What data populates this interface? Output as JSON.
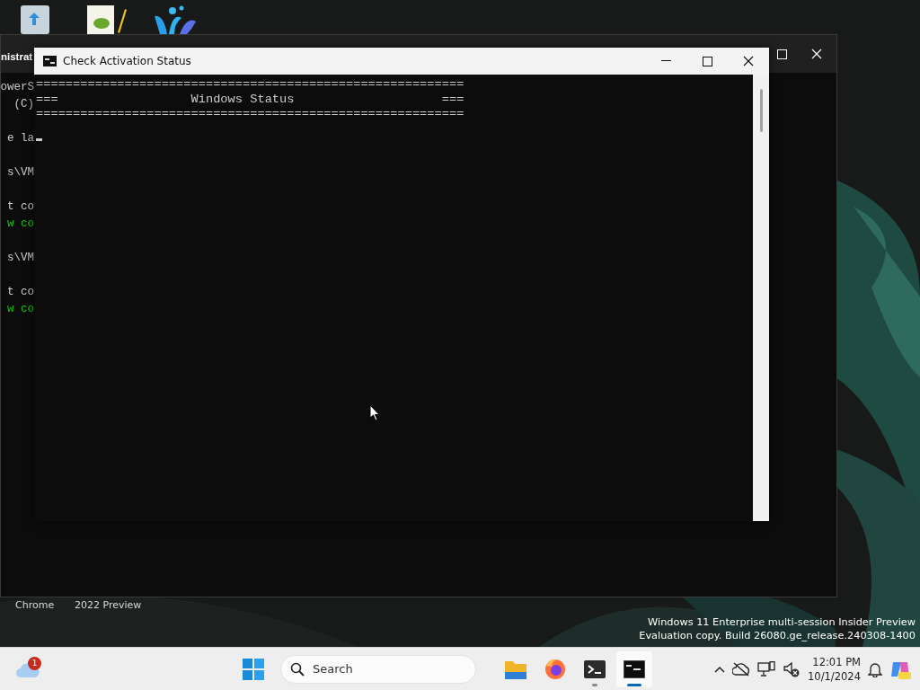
{
  "desktop_icons": [
    {
      "kind": "recycle"
    },
    {
      "kind": "notepad"
    },
    {
      "kind": "splash"
    }
  ],
  "desktop_labels": [
    "Chrome",
    "2022 Preview"
  ],
  "back_window": {
    "title": "nistrat",
    "paragraphs": [
      [
        {
          "text": "owerS",
          "color": "#cccccc"
        },
        {
          "text": "(C)",
          "color": "#cccccc"
        }
      ],
      [
        {
          "text": "e la",
          "color": "#cccccc"
        }
      ],
      [
        {
          "text": "s\\VM",
          "color": "#cccccc"
        }
      ],
      [
        {
          "text": "t co",
          "color": "#cccccc"
        },
        {
          "text": "w co",
          "color": "#16c60c"
        }
      ],
      [
        {
          "text": "s\\VM",
          "color": "#cccccc"
        }
      ],
      [
        {
          "text": "t co",
          "color": "#cccccc"
        },
        {
          "text": "w co",
          "color": "#16c60c"
        }
      ]
    ]
  },
  "front_window": {
    "title": "Check Activation Status",
    "lines": [
      "==========================================================",
      "===                  Windows Status                    ===",
      "=========================================================="
    ],
    "cursor": true
  },
  "os_notice": [
    "Windows 11 Enterprise multi-session Insider Preview",
    "Evaluation copy. Build 26080.ge_release.240308-1400"
  ],
  "taskbar": {
    "weather_badge": "1",
    "search": {
      "placeholder": "Search"
    },
    "apps": [
      {
        "kind": "explorer",
        "running": false,
        "selected": false
      },
      {
        "kind": "firefox",
        "running": false,
        "selected": false
      },
      {
        "kind": "terminal",
        "running": true,
        "selected": false
      },
      {
        "kind": "cmd",
        "running": true,
        "selected": true
      }
    ],
    "clock": {
      "time": "12:01 PM",
      "date": "10/1/2024"
    }
  }
}
